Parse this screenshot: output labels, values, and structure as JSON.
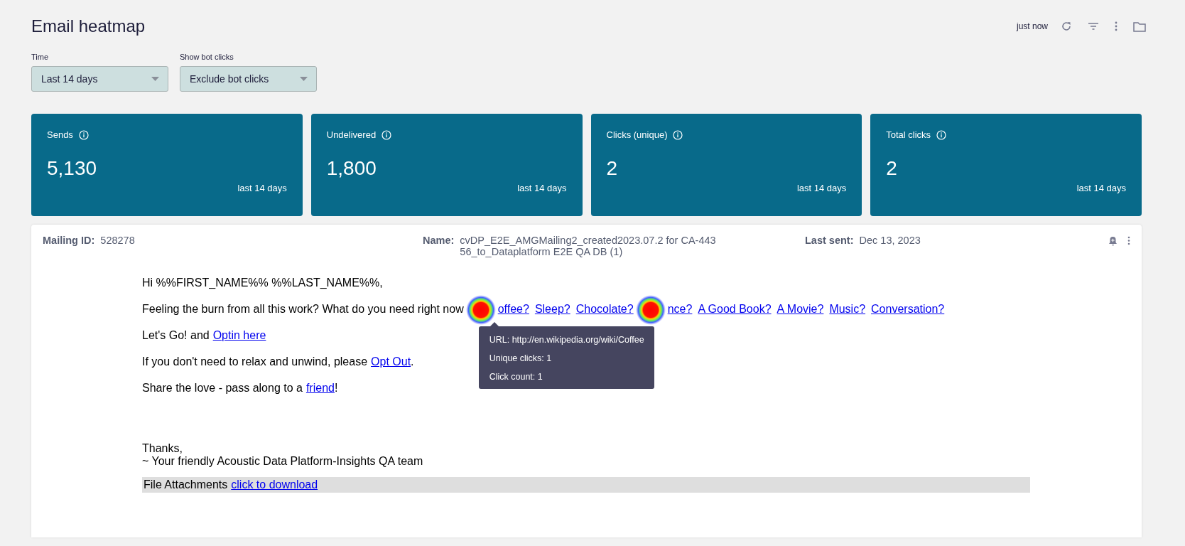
{
  "header": {
    "title": "Email heatmap",
    "updated": "just now"
  },
  "filters": [
    {
      "label": "Time",
      "value": "Last 14 days"
    },
    {
      "label": "Show bot clicks",
      "value": "Exclude bot clicks"
    }
  ],
  "stats": [
    {
      "label": "Sends",
      "value": "5,130",
      "period": "last 14 days"
    },
    {
      "label": "Undelivered",
      "value": "1,800",
      "period": "last 14 days"
    },
    {
      "label": "Clicks (unique)",
      "value": "2",
      "period": "last 14 days"
    },
    {
      "label": "Total clicks",
      "value": "2",
      "period": "last 14 days"
    }
  ],
  "mailing": {
    "id_label": "Mailing ID:",
    "id": "528278",
    "name_label": "Name:",
    "name": "cvDP_E2E_AMGMailing2_created2023.07.2 for CA-44356_to_Dataplatform E2E QA DB (1)",
    "last_sent_label": "Last sent:",
    "last_sent": "Dec 13, 2023",
    "body": [
      {
        "segments": [
          {
            "kind": "text",
            "text": "Hi %%FIRST_NAME%% %%LAST_NAME%%,"
          }
        ]
      },
      {
        "segments": [
          {
            "kind": "text",
            "text": "Feeling the burn from all this work? What do you need right now"
          },
          {
            "kind": "hotspot",
            "tooltip": true
          },
          {
            "kind": "link",
            "text": "offee?"
          },
          {
            "kind": "link",
            "text": "Sleep?"
          },
          {
            "kind": "link",
            "text": "Chocolate?"
          },
          {
            "kind": "hotspot"
          },
          {
            "kind": "link",
            "text": "nce?"
          },
          {
            "kind": "link",
            "text": "A Good Book?"
          },
          {
            "kind": "link",
            "text": "A Movie?"
          },
          {
            "kind": "link",
            "text": "Music?"
          },
          {
            "kind": "link",
            "text": "Conversation?"
          }
        ]
      },
      {
        "segments": [
          {
            "kind": "text",
            "text": "Let's Go! and"
          },
          {
            "kind": "link",
            "text": "Optin here"
          }
        ]
      },
      {
        "segments": [
          {
            "kind": "text",
            "text": "If you don't need to relax and unwind, please"
          },
          {
            "kind": "link",
            "text": "Opt Out"
          },
          {
            "kind": "text",
            "text": "."
          }
        ]
      },
      {
        "segments": [
          {
            "kind": "text",
            "text": "Share the love - pass along to a"
          },
          {
            "kind": "link",
            "text": "friend"
          },
          {
            "kind": "text",
            "text": "!"
          }
        ]
      }
    ],
    "signoff": [
      "Thanks,",
      "~ Your friendly Acoustic Data Platform-Insights QA team"
    ],
    "attachments": [
      {
        "kind": "text",
        "text": "File Attachments"
      },
      {
        "kind": "link",
        "text": "click to download"
      }
    ]
  },
  "tooltip": {
    "lines": [
      "URL: http://en.wikipedia.org/wiki/Coffee",
      "Unique clicks: 1",
      "Click count: 1"
    ]
  }
}
